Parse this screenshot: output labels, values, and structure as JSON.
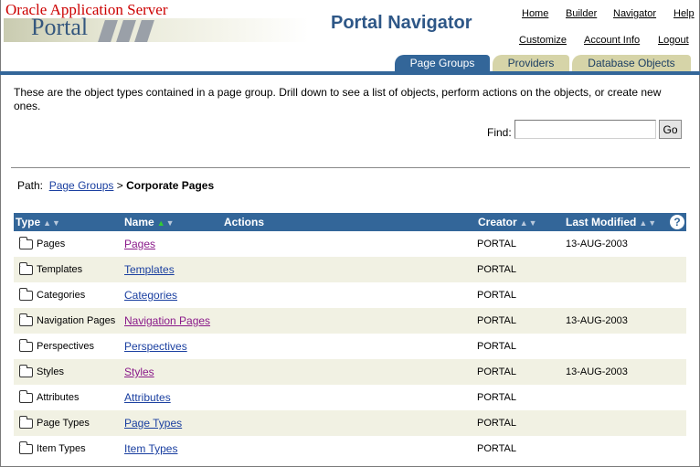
{
  "header": {
    "brand_line1": "Oracle Application Server",
    "brand_line2": "Portal",
    "app_title": "Portal Navigator",
    "links_row1": [
      "Home",
      "Builder",
      "Navigator",
      "Help"
    ],
    "links_row2": [
      "Customize",
      "Account Info",
      "Logout"
    ]
  },
  "tabs": [
    {
      "label": "Page Groups",
      "active": true
    },
    {
      "label": "Providers",
      "active": false
    },
    {
      "label": "Database Objects",
      "active": false
    }
  ],
  "intro_text": "These are the object types contained in a page group. Drill down to see a list of objects, perform actions on the objects, or create new ones.",
  "find": {
    "label": "Find:",
    "value": "",
    "button": "Go"
  },
  "path": {
    "label": "Path:",
    "link": "Page Groups",
    "separator": ">",
    "current": "Corporate Pages"
  },
  "table": {
    "columns": [
      "Type",
      "Name",
      "Actions",
      "Creator",
      "Last Modified"
    ],
    "help_glyph": "?",
    "rows": [
      {
        "type": "Pages",
        "name": "Pages",
        "creator": "PORTAL",
        "modified": "13-AUG-2003",
        "visited": true
      },
      {
        "type": "Templates",
        "name": "Templates",
        "creator": "PORTAL",
        "modified": "",
        "visited": false
      },
      {
        "type": "Categories",
        "name": "Categories",
        "creator": "PORTAL",
        "modified": "",
        "visited": false
      },
      {
        "type": "Navigation Pages",
        "name": "Navigation Pages",
        "creator": "PORTAL",
        "modified": "13-AUG-2003",
        "visited": true
      },
      {
        "type": "Perspectives",
        "name": "Perspectives",
        "creator": "PORTAL",
        "modified": "",
        "visited": false
      },
      {
        "type": "Styles",
        "name": "Styles",
        "creator": "PORTAL",
        "modified": "13-AUG-2003",
        "visited": true
      },
      {
        "type": "Attributes",
        "name": "Attributes",
        "creator": "PORTAL",
        "modified": "",
        "visited": false
      },
      {
        "type": "Page Types",
        "name": "Page Types",
        "creator": "PORTAL",
        "modified": "",
        "visited": false
      },
      {
        "type": "Item Types",
        "name": "Item Types",
        "creator": "PORTAL",
        "modified": "",
        "visited": false
      }
    ]
  },
  "colors": {
    "header_blue": "#336699",
    "tab_inactive": "#d6d4a8",
    "row_alt": "#f1f1e3",
    "link": "#1a3fa0",
    "visited_link": "#8a1a8a",
    "brand_red": "#cc0000"
  }
}
